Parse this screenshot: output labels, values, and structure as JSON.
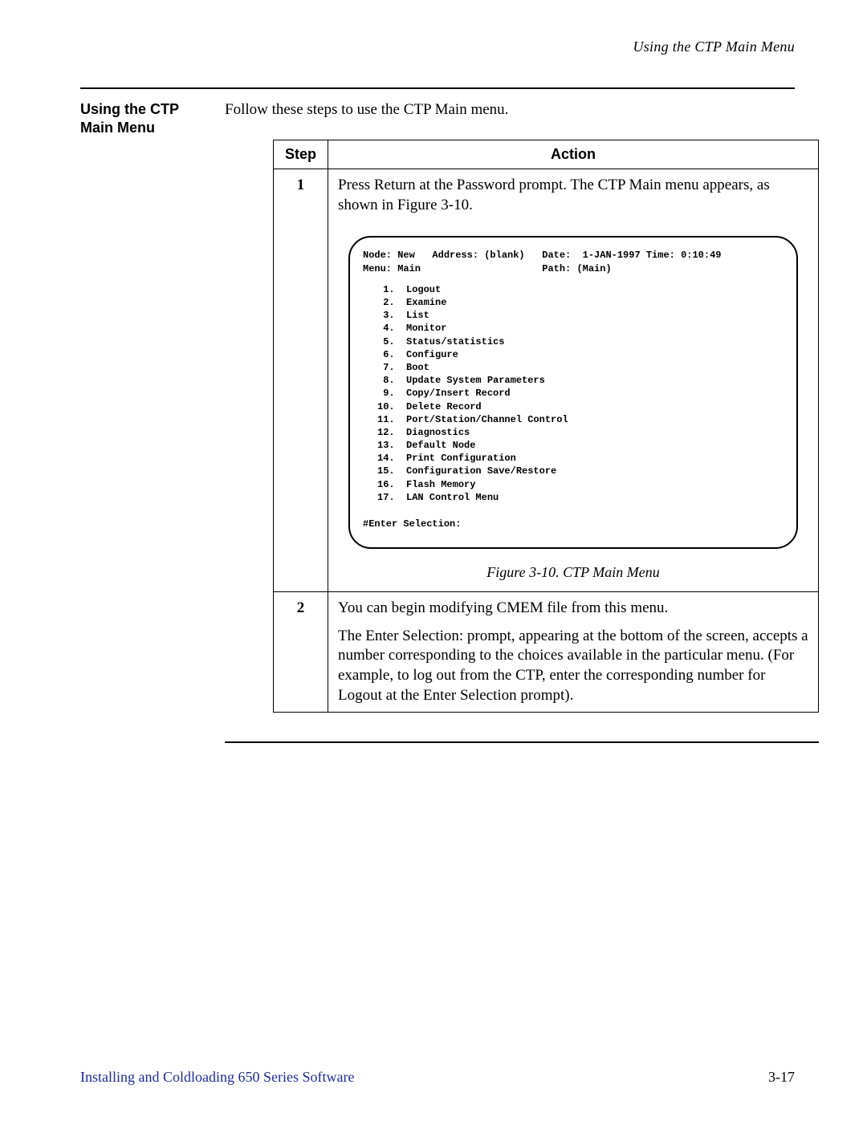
{
  "running_head": "Using the CTP Main Menu",
  "gutter_heading": "Using the CTP Main Menu",
  "intro": "Follow these steps to use the CTP Main menu.",
  "table": {
    "head_step": "Step",
    "head_action": "Action",
    "rows": [
      {
        "num": "1",
        "text": "Press Return at the Password prompt. The CTP Main menu appears, as shown in Figure 3-10.",
        "terminal": {
          "line1": "Node: New   Address: (blank)   Date:  1-JAN-1997 Time: 0:10:49",
          "line2": "Menu: Main                     Path: (Main)",
          "items": [
            " 1.  Logout",
            " 2.  Examine",
            " 3.  List",
            " 4.  Monitor",
            " 5.  Status/statistics",
            " 6.  Configure",
            " 7.  Boot",
            " 8.  Update System Parameters",
            " 9.  Copy/Insert Record",
            "10.  Delete Record",
            "11.  Port/Station/Channel Control",
            "12.  Diagnostics",
            "13.  Default Node",
            "14.  Print Configuration",
            "15.  Configuration Save/Restore",
            "16.  Flash Memory",
            "17.  LAN Control Menu"
          ],
          "prompt": "#Enter Selection:"
        },
        "caption": "Figure 3-10. CTP Main Menu"
      },
      {
        "num": "2",
        "text1": "You can begin modifying CMEM file from this menu.",
        "text2": "The Enter Selection: prompt, appearing at the bottom of the screen, accepts a number corresponding to the choices available in the particular menu. (For example, to log out from the CTP, enter the corresponding number for Logout at the Enter Selection prompt)."
      }
    ]
  },
  "footer": {
    "left": "Installing and Coldloading 650 Series Software",
    "right": "3-17"
  }
}
